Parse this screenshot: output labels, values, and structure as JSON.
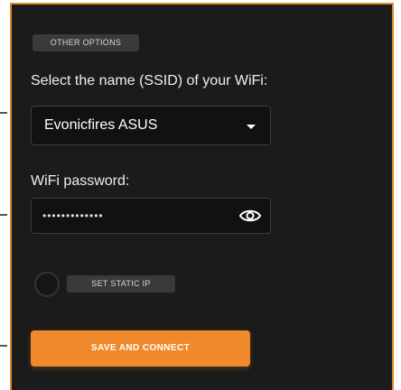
{
  "section_badge": "OTHER OPTIONS",
  "ssid": {
    "label": "Select the name (SSID) of your WiFi:",
    "selected": "Evonicfires ASUS",
    "icon": "chevron-down-icon"
  },
  "password": {
    "label": "WiFi password:",
    "value": "•••••••••••••",
    "icon": "eye-icon"
  },
  "static_ip": {
    "label": "SET STATIC IP",
    "checked": false
  },
  "save_button": "SAVE AND CONNECT",
  "colors": {
    "accent": "#f0892b",
    "border": "#e08a2c",
    "panel": "#1b1b1b"
  }
}
